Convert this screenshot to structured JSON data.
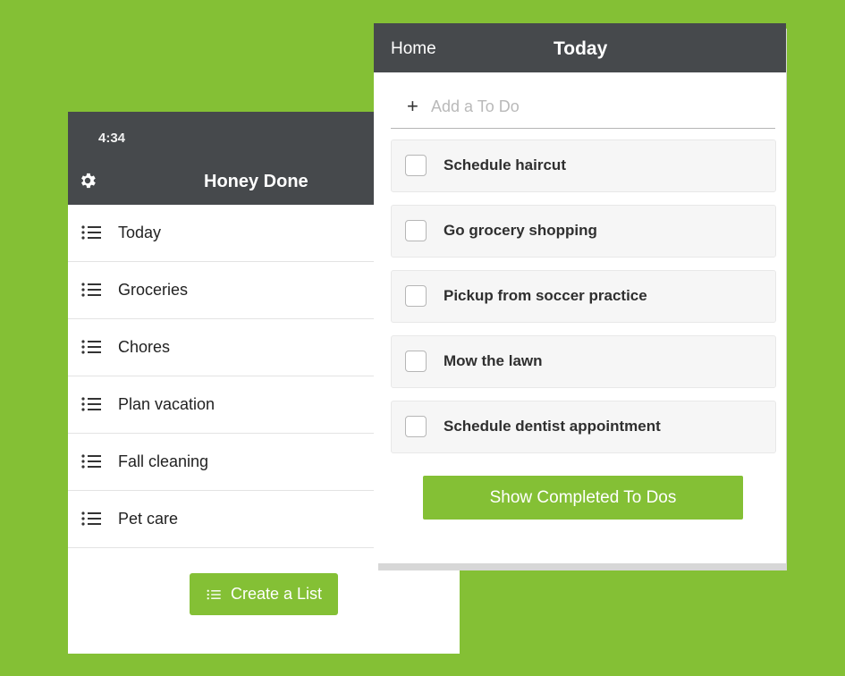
{
  "colors": {
    "background": "#84c035",
    "header": "#46494c",
    "accent": "#84c035"
  },
  "lists_screen": {
    "status_time": "4:34",
    "title": "Honey Done",
    "settings_icon": "gear-icon",
    "items": [
      {
        "label": "Today",
        "icon": "list-icon"
      },
      {
        "label": "Groceries",
        "icon": "list-icon"
      },
      {
        "label": "Chores",
        "icon": "list-icon"
      },
      {
        "label": "Plan vacation",
        "icon": "list-icon"
      },
      {
        "label": "Fall cleaning",
        "icon": "list-icon"
      },
      {
        "label": "Pet care",
        "icon": "list-icon"
      }
    ],
    "create_button_label": "Create a List"
  },
  "today_screen": {
    "back_label": "Home",
    "title": "Today",
    "add_placeholder": "Add a To Do",
    "todos": [
      {
        "label": "Schedule haircut",
        "checked": false
      },
      {
        "label": "Go grocery shopping",
        "checked": false
      },
      {
        "label": "Pickup from soccer practice",
        "checked": false
      },
      {
        "label": "Mow the lawn",
        "checked": false
      },
      {
        "label": "Schedule dentist appointment",
        "checked": false
      }
    ],
    "show_completed_label": "Show Completed To Dos"
  }
}
